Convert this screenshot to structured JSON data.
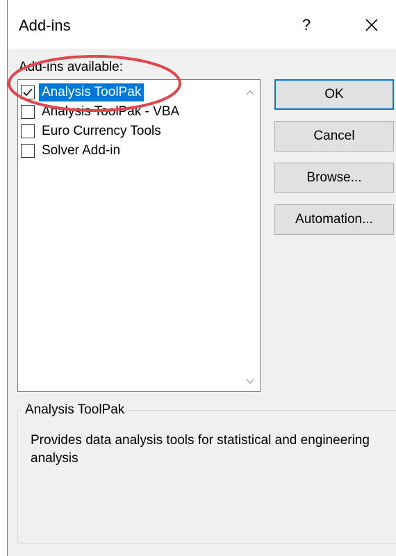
{
  "dialog": {
    "title": "Add-ins",
    "help_label": "?",
    "available_label": "Add-ins available:",
    "items": [
      {
        "label": "Analysis ToolPak",
        "checked": true,
        "selected": true
      },
      {
        "label": "Analysis ToolPak - VBA",
        "checked": false,
        "selected": false
      },
      {
        "label": "Euro Currency Tools",
        "checked": false,
        "selected": false
      },
      {
        "label": "Solver Add-in",
        "checked": false,
        "selected": false
      }
    ],
    "buttons": {
      "ok": "OK",
      "cancel": "Cancel",
      "browse": "Browse...",
      "automation": "Automation..."
    },
    "description": {
      "title": "Analysis ToolPak",
      "text": "Provides data analysis tools for statistical and engineering analysis"
    }
  },
  "colors": {
    "selection": "#0078d7",
    "annotation": "#e0474c",
    "dialog_bg": "#f0f0f0"
  }
}
